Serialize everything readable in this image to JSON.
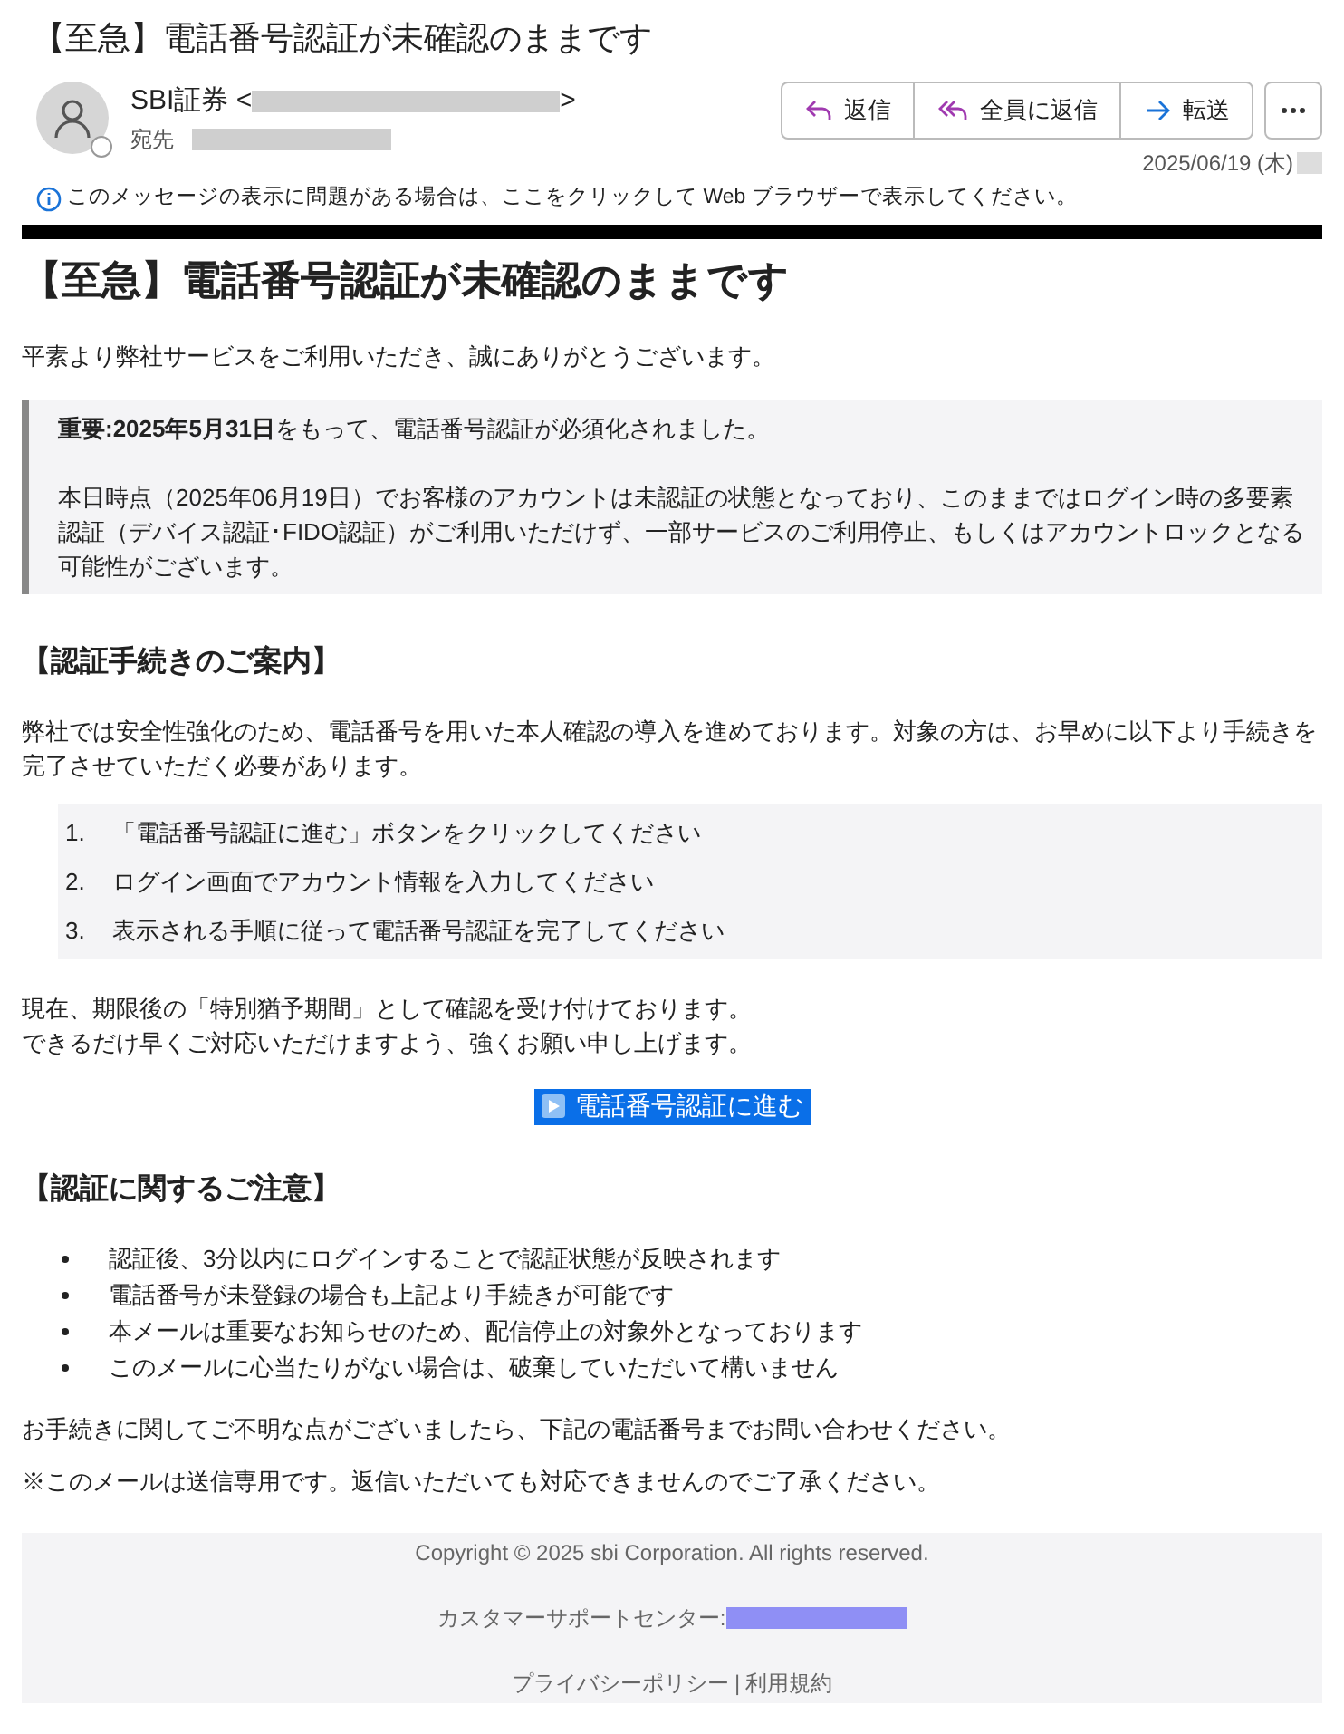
{
  "subject": "【至急】電話番号認証が未確認のままです",
  "sender": {
    "name": "SBI証券 <",
    "name_end": ">",
    "to_label": "宛先",
    "date": "2025/06/19 (木)"
  },
  "actions": [
    {
      "kind": "reply",
      "label": "返信"
    },
    {
      "kind": "reply_all",
      "label": "全員に返信"
    },
    {
      "kind": "forward",
      "label": "転送"
    }
  ],
  "info_bar": "このメッセージの表示に問題がある場合は、ここをクリックして Web ブラウザーで表示してください。",
  "body": {
    "heading": "【至急】電話番号認証が未確認のままです",
    "greeting": "平素より弊社サービスをご利用いただき、誠にありがとうございます。",
    "notice": [
      "**重要:2025年5月31日**をもって、電話番号認証が必須化されました。",
      "本日時点（2025年06月19日）でお客様のアカウントは未認証の状態となっており、このままではログイン時の多要素認証（デバイス認証･FIDO認証）がご利用いただけず、一部サービスのご利用停止、もしくはアカウントロックとなる可能性がございます。"
    ],
    "section1_title": "【認証手続きのご案内】",
    "section1_text": "弊社では安全性強化のため、電話番号を用いた本人確認の導入を進めております。対象の方は、お早めに以下より手続きを完了させていただく必要があります。",
    "steps": [
      {
        "number": "1.",
        "text": "「電話番号認証に進む」ボタンをクリックしてください"
      },
      {
        "number": "2.",
        "text": "ログイン画面でアカウント情報を入力してください"
      },
      {
        "number": "3.",
        "text": "表示される手順に従って電話番号認証を完了してください"
      }
    ],
    "grace": [
      "現在、期限後の「特別猶予期間」として確認を受け付けております。",
      "できるだけ早くご対応いただけますよう、強くお願い申し上げます。"
    ],
    "cta": "電話番号認証に進む",
    "section2_title": "【認証に関するご注意】",
    "notes": [
      "認証後、3分以内にログインすることで認証状態が反映されます",
      "電話番号が未登録の場合も上記より手続きが可能です",
      "本メールは重要なお知らせのため、配信停止の対象外となっております",
      "このメールに心当たりがない場合は、破棄していただいて構いません"
    ],
    "contact": "お手続きに関してご不明な点がございましたら、下記の電話番号までお問い合わせください。",
    "send_only": "※このメールは送信専用です。返信いただいても対応できませんのでご了承ください。"
  },
  "footer": {
    "copyright": "Copyright © 2025 sbi Corporation. All rights reserved.",
    "support_label": "カスタマーサポートセンター:",
    "links": [
      "プライバシーポリシー",
      "利用規約"
    ],
    "separator": "|"
  }
}
